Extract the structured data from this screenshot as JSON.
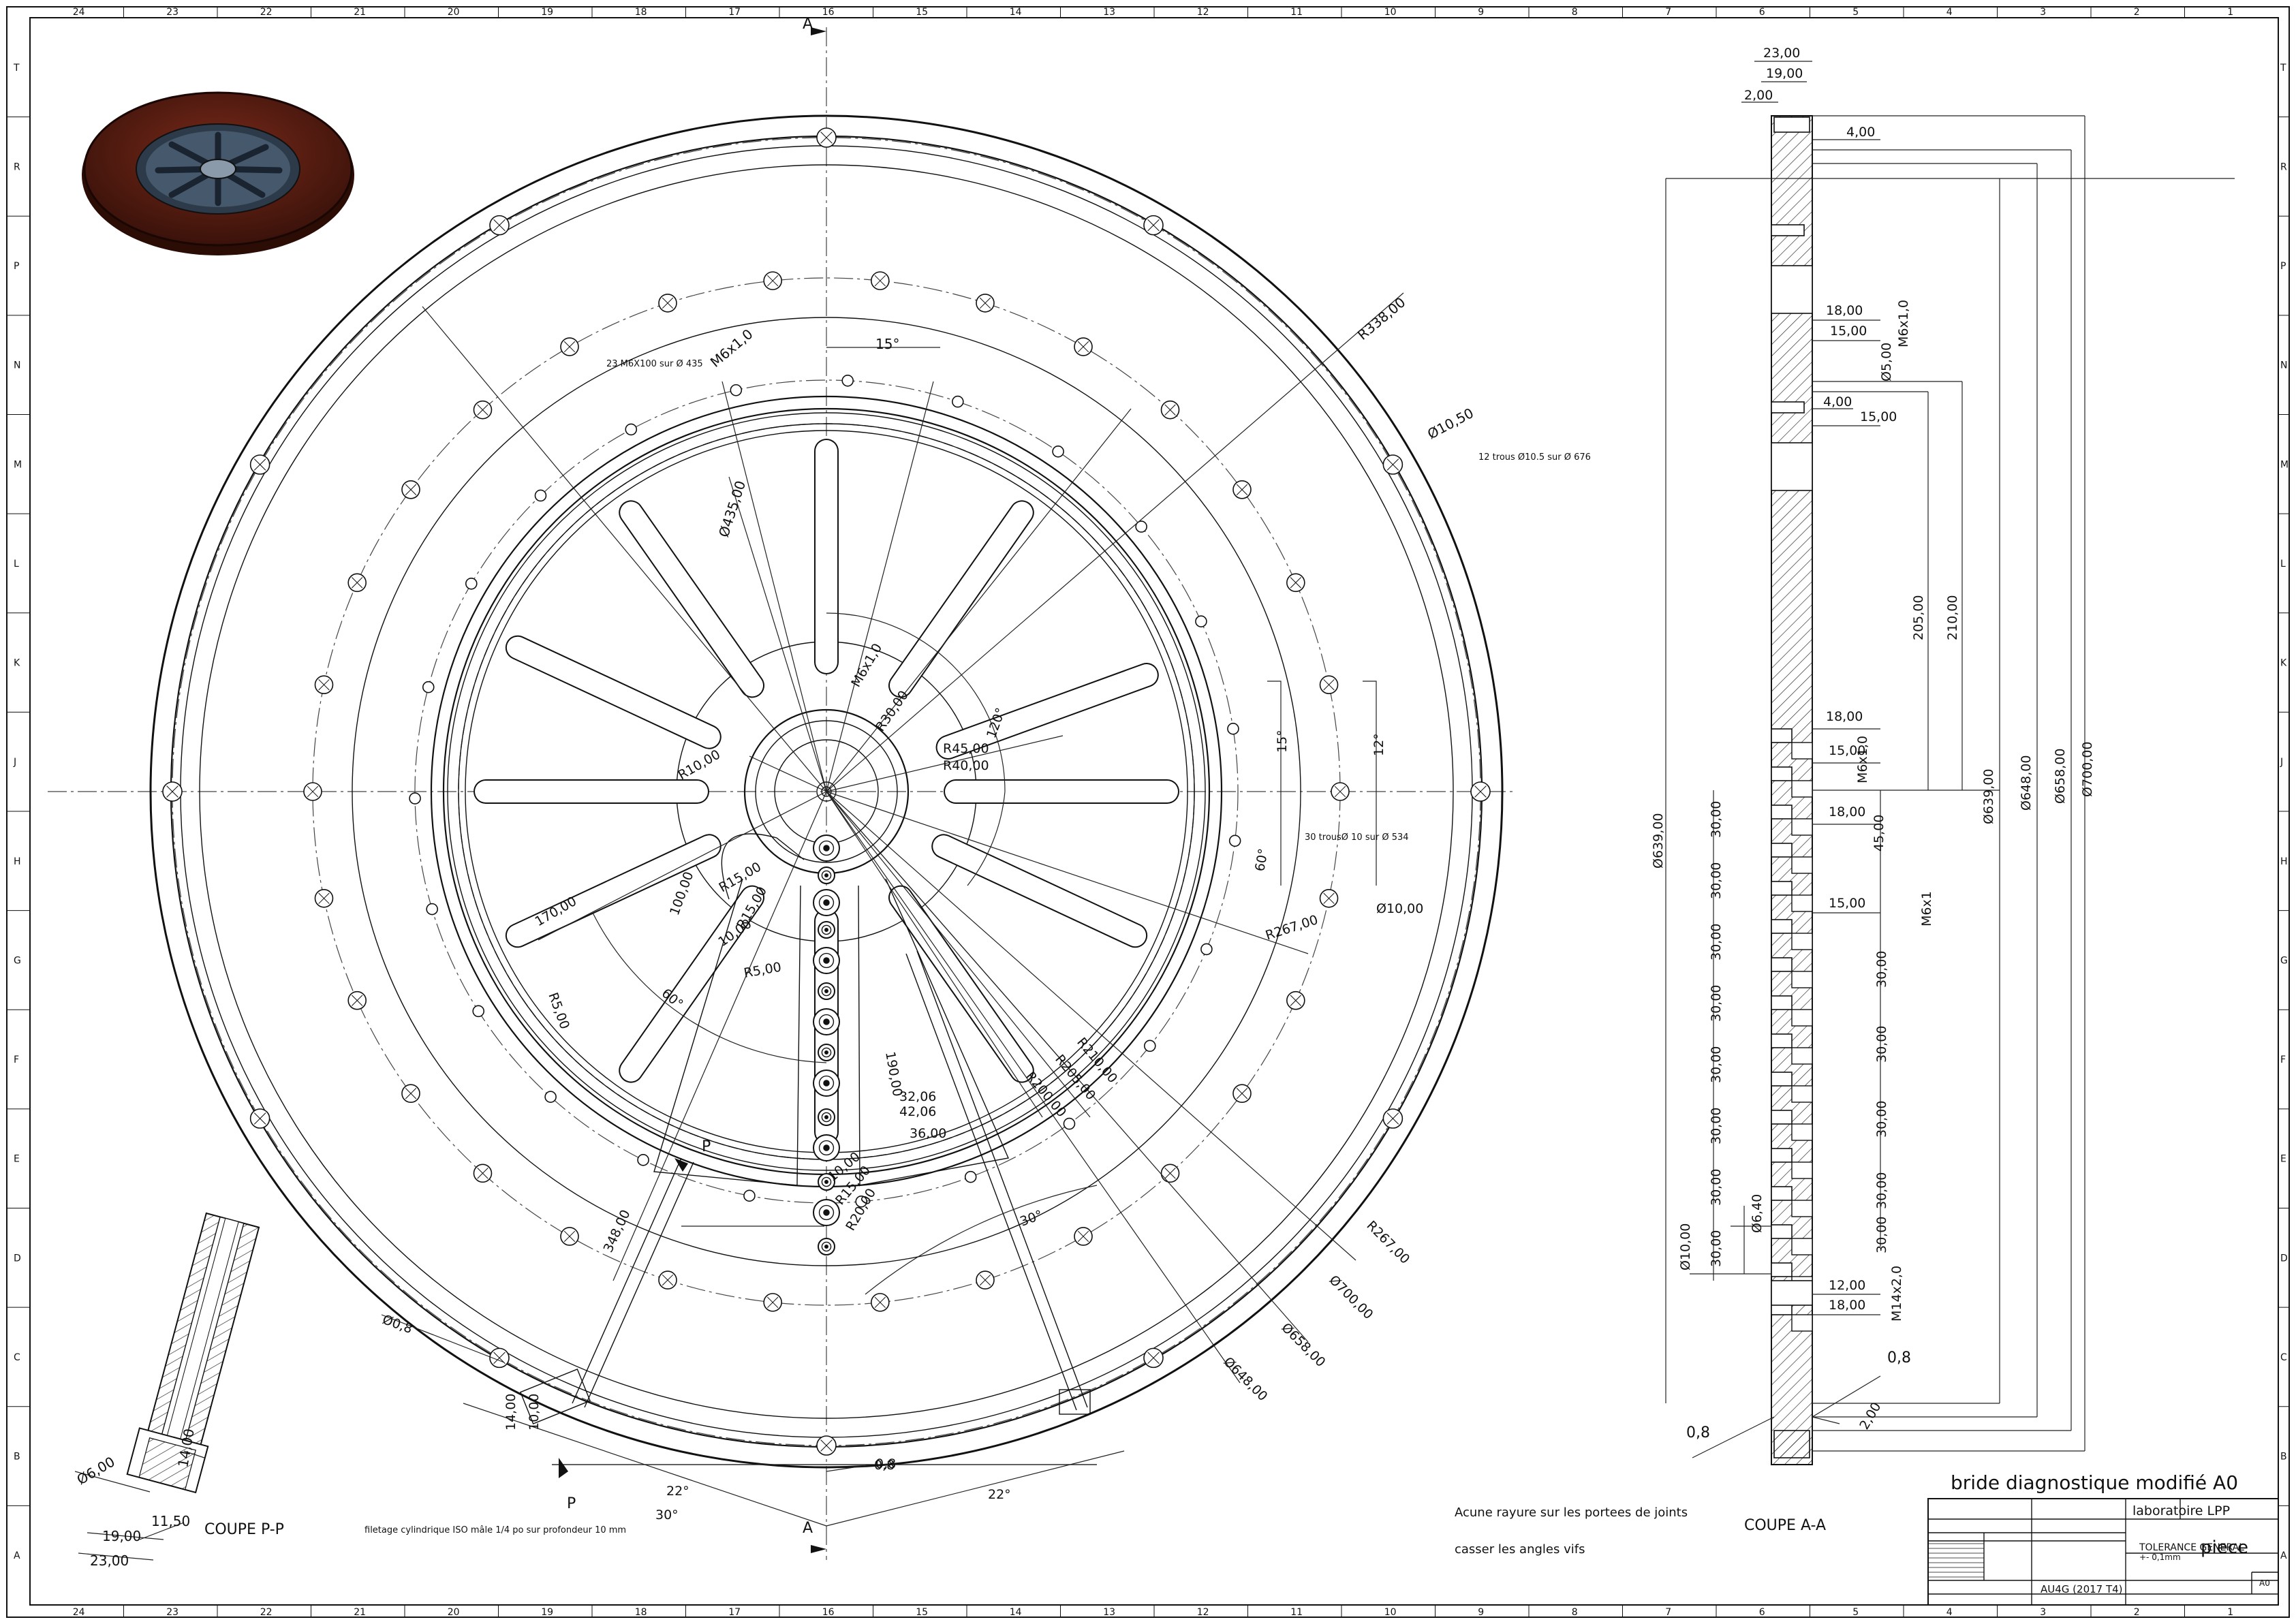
{
  "sheet": {
    "cols": [
      "24",
      "23",
      "22",
      "21",
      "20",
      "19",
      "18",
      "17",
      "16",
      "15",
      "14",
      "13",
      "12",
      "11",
      "10",
      "9",
      "8",
      "7",
      "6",
      "5",
      "4",
      "3",
      "2",
      "1"
    ],
    "rows": [
      "T",
      "R",
      "P",
      "N",
      "M",
      "L",
      "K",
      "J",
      "H",
      "G",
      "F",
      "E",
      "D",
      "C",
      "B",
      "A"
    ]
  },
  "section_marks": {
    "a_top": "A",
    "a_bottom": "A",
    "p_top": "P",
    "p_bottom": "P"
  },
  "front_view": {
    "callouts": {
      "hole_23": "23 M6X100 sur Ø 435",
      "hole_12": "12 trous Ø10.5 sur Ø 676",
      "hole_30": "30 trousØ 10 sur Ø 534",
      "thread": "filetage cylindrique ISO mâle 1/4 po sur profondeur 10 mm"
    },
    "dims": [
      "Ø435,00",
      "M6x1,0",
      "15°",
      "R338,00",
      "Ø10,50",
      "M6x1,0",
      "R30,00",
      "120°",
      "R45,00",
      "R40,00",
      "R10,00",
      "15°",
      "12°",
      "Ø10,00",
      "R267,00",
      "60°",
      "170,00",
      "R15,00",
      "100,00",
      "R15,00",
      "10,00",
      "R5,00",
      "R5,00",
      "60°",
      "Ø0,8",
      "R210,00",
      "R205,00",
      "R200,00",
      "190,00",
      "32,06",
      "42,06",
      "36,00",
      "10,00",
      "R15,00",
      "R20,00",
      "30°",
      "348,00",
      "R267,00",
      "Ø700,00",
      "Ø658,00",
      "Ø648,00",
      "14,00",
      "10,00",
      "22°",
      "0,8",
      "30°",
      "22°",
      "0,8"
    ]
  },
  "section_pp": {
    "title": "COUPE P-P",
    "dims": [
      "Ø6,00",
      "14,00",
      "11,50",
      "19,00",
      "23,00"
    ]
  },
  "section_aa": {
    "title": "COUPE A-A",
    "top_dims": [
      "23,00",
      "19,00",
      "2,00",
      "4,00"
    ],
    "mid_dims": [
      "18,00",
      "15,00",
      "Ø5,00",
      "M6x1,0",
      "4,00",
      "15,00"
    ],
    "vert_dims": [
      "205,00",
      "210,00",
      "Ø639,00",
      "Ø648,00",
      "Ø658,00",
      "Ø700,00",
      "Ø639,00"
    ],
    "lower_dims": [
      "18,00",
      "15,00",
      "M6x1,0",
      "18,00",
      "45,00",
      "15,00",
      "M6x1",
      "30,00",
      "30,00",
      "30,00",
      "30,00",
      "30,00",
      "Ø6,40",
      "Ø10,00",
      "M14x2,0",
      "12,00",
      "18,00",
      "0,8",
      "0,8",
      "2,00"
    ],
    "left_30s": [
      "30,00",
      "30,00",
      "30,00",
      "30,00",
      "30,00",
      "30,00",
      "30,00",
      "30,00"
    ]
  },
  "notes": {
    "note1": "Acune rayure sur les portees de joints",
    "note2": "casser les angles vifs"
  },
  "title_block": {
    "title": "bride diagnostique modifié A0",
    "company": "laboratoire LPP",
    "tolerance": "TOLERANCE GENERAL",
    "tolerance2": "+- 0,1mm",
    "name_label": "piece",
    "material": "AU4G (2017 T4)",
    "format": "A0"
  }
}
